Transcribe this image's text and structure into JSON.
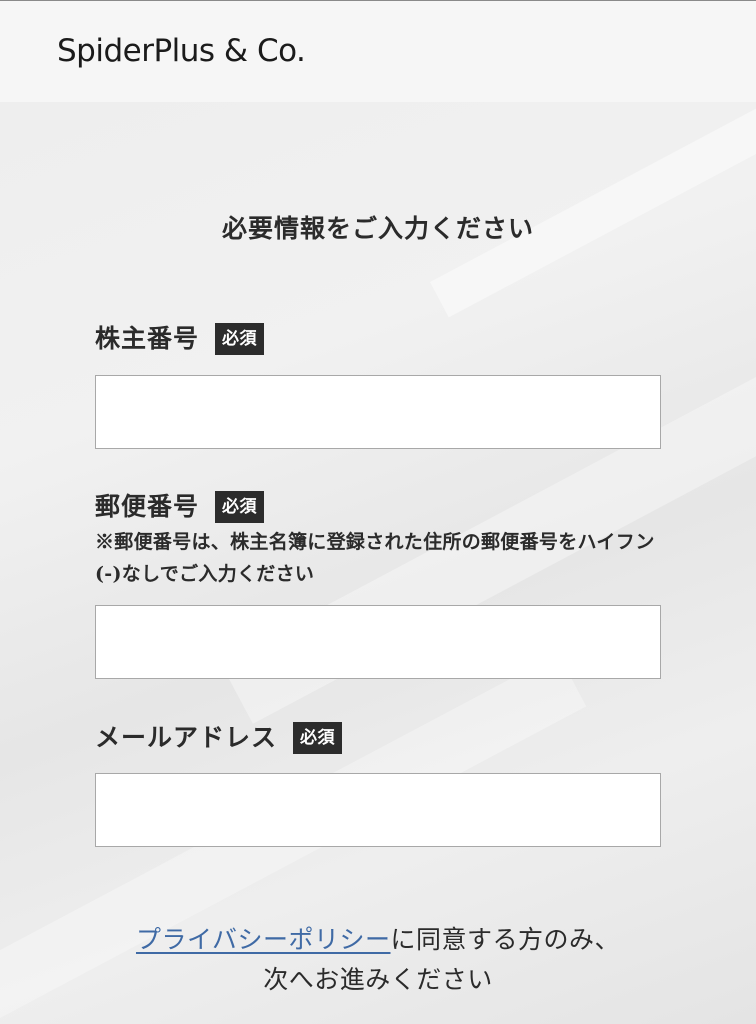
{
  "header": {
    "logo_text": "SpiderPlus & Co."
  },
  "form": {
    "title": "必要情報をご入力ください",
    "required_badge": "必須",
    "shareholder_number": {
      "label": "株主番号",
      "value": "",
      "placeholder": ""
    },
    "postal_code": {
      "label": "郵便番号",
      "note": "※郵便番号は、株主名簿に登録された住所の郵便番号をハイフン(-)なしでご入力ください",
      "value": "",
      "placeholder": ""
    },
    "email": {
      "label": "メールアドレス",
      "value": "",
      "placeholder": ""
    }
  },
  "consent": {
    "privacy_link": "プライバシーポリシー",
    "line1_suffix": "に同意する方のみ、",
    "line2": "次へお進みください"
  },
  "colors": {
    "badge_bg": "#2c2c2c",
    "link": "#3f6aa5",
    "header_bg": "#f6f6f6"
  }
}
